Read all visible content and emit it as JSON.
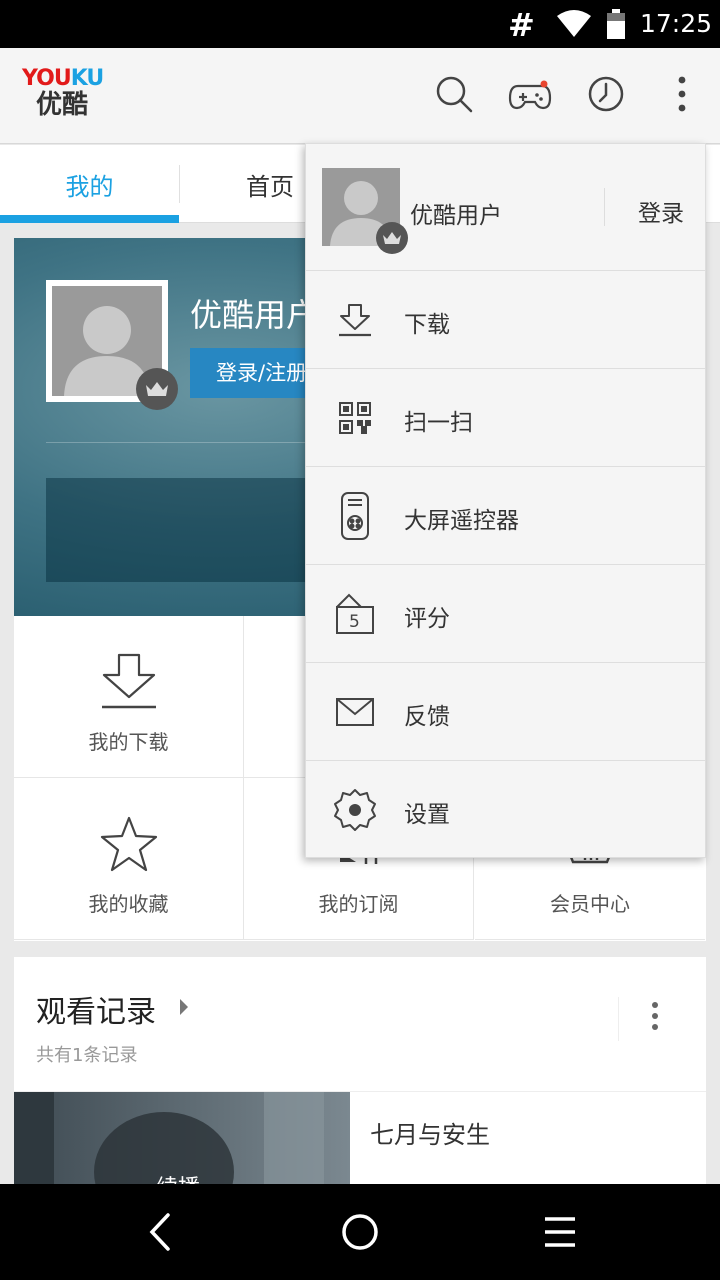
{
  "status_bar": {
    "signal_glyph": "#",
    "time": "17:25",
    "wifi_icon": "wifi-icon",
    "battery_icon": "battery-icon"
  },
  "app_bar": {
    "logo_en": {
      "part1": "YOU",
      "part2": "KU"
    },
    "logo_cn": "优酷",
    "actions": [
      "search-icon",
      "gamepad-icon",
      "history-icon",
      "more-vert-icon"
    ],
    "notification_dot_color": "#e8452f"
  },
  "tabs": [
    {
      "label": "我的",
      "active": true
    },
    {
      "label": "首页",
      "active": false
    }
  ],
  "profile": {
    "username": "优酷用户",
    "login_button": "登录/注册"
  },
  "grid": {
    "items": [
      {
        "label": "我的下载",
        "icon": "download-icon"
      },
      {
        "label": "",
        "icon": ""
      },
      {
        "label": "",
        "icon": ""
      },
      {
        "label": "我的收藏",
        "icon": "star-icon"
      },
      {
        "label": "我的订阅",
        "icon": "subscribe-icon"
      },
      {
        "label": "会员中心",
        "icon": "vip-icon"
      }
    ]
  },
  "history": {
    "title": "观看记录",
    "subtitle": "共有1条记录",
    "thumb_text": "续播",
    "video_title": "七月与安生"
  },
  "menu": {
    "username": "优酷用户",
    "login": "登录",
    "items": [
      {
        "label": "下载",
        "icon": "download-icon"
      },
      {
        "label": "扫一扫",
        "icon": "qr-scan-icon"
      },
      {
        "label": "大屏遥控器",
        "icon": "remote-control-icon"
      },
      {
        "label": "评分",
        "icon": "rating-icon",
        "icon_text": "5"
      },
      {
        "label": "反馈",
        "icon": "mail-icon"
      },
      {
        "label": "设置",
        "icon": "settings-icon"
      }
    ]
  },
  "nav_bar": [
    "back-icon",
    "home-icon",
    "menu-icon"
  ],
  "colors": {
    "accent": "#1ba1e2",
    "logo_red": "#e21a1a",
    "login_button": "#2787c2"
  }
}
